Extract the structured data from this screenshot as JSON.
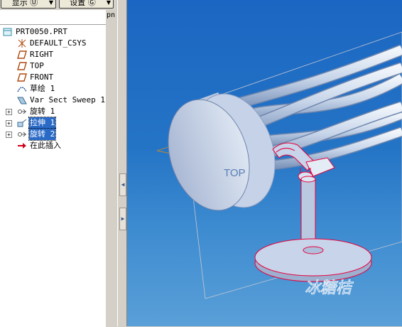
{
  "toolbar": {
    "display_btn": "显示 Ⓤ",
    "settings_btn": "设置 Ⓖ"
  },
  "column_header": "pn",
  "tree": {
    "root": "PRT0050.PRT",
    "items": [
      {
        "label": "DEFAULT_CSYS",
        "icon": "csys-icon"
      },
      {
        "label": "RIGHT",
        "icon": "datum-plane-icon"
      },
      {
        "label": "TOP",
        "icon": "datum-plane-icon"
      },
      {
        "label": "FRONT",
        "icon": "datum-plane-icon"
      },
      {
        "label": "草绘 1",
        "icon": "sketch-icon"
      },
      {
        "label": "Var Sect Sweep 1",
        "icon": "sweep-icon"
      },
      {
        "label": "旋转 1",
        "icon": "revolve-icon"
      },
      {
        "label": "拉伸 1",
        "icon": "extrude-icon"
      },
      {
        "label": "旋转 2",
        "icon": "revolve-icon"
      },
      {
        "label": "在此插入",
        "icon": "insert-here-icon"
      }
    ]
  },
  "viewport": {
    "datum_label": "TOP",
    "watermark": "冰糖桔"
  },
  "colors": {
    "viewport_top": "#1b66c2",
    "viewport_bottom": "#5aa0d8",
    "selection": "#2a6ac7",
    "highlight": "#e8003c"
  }
}
